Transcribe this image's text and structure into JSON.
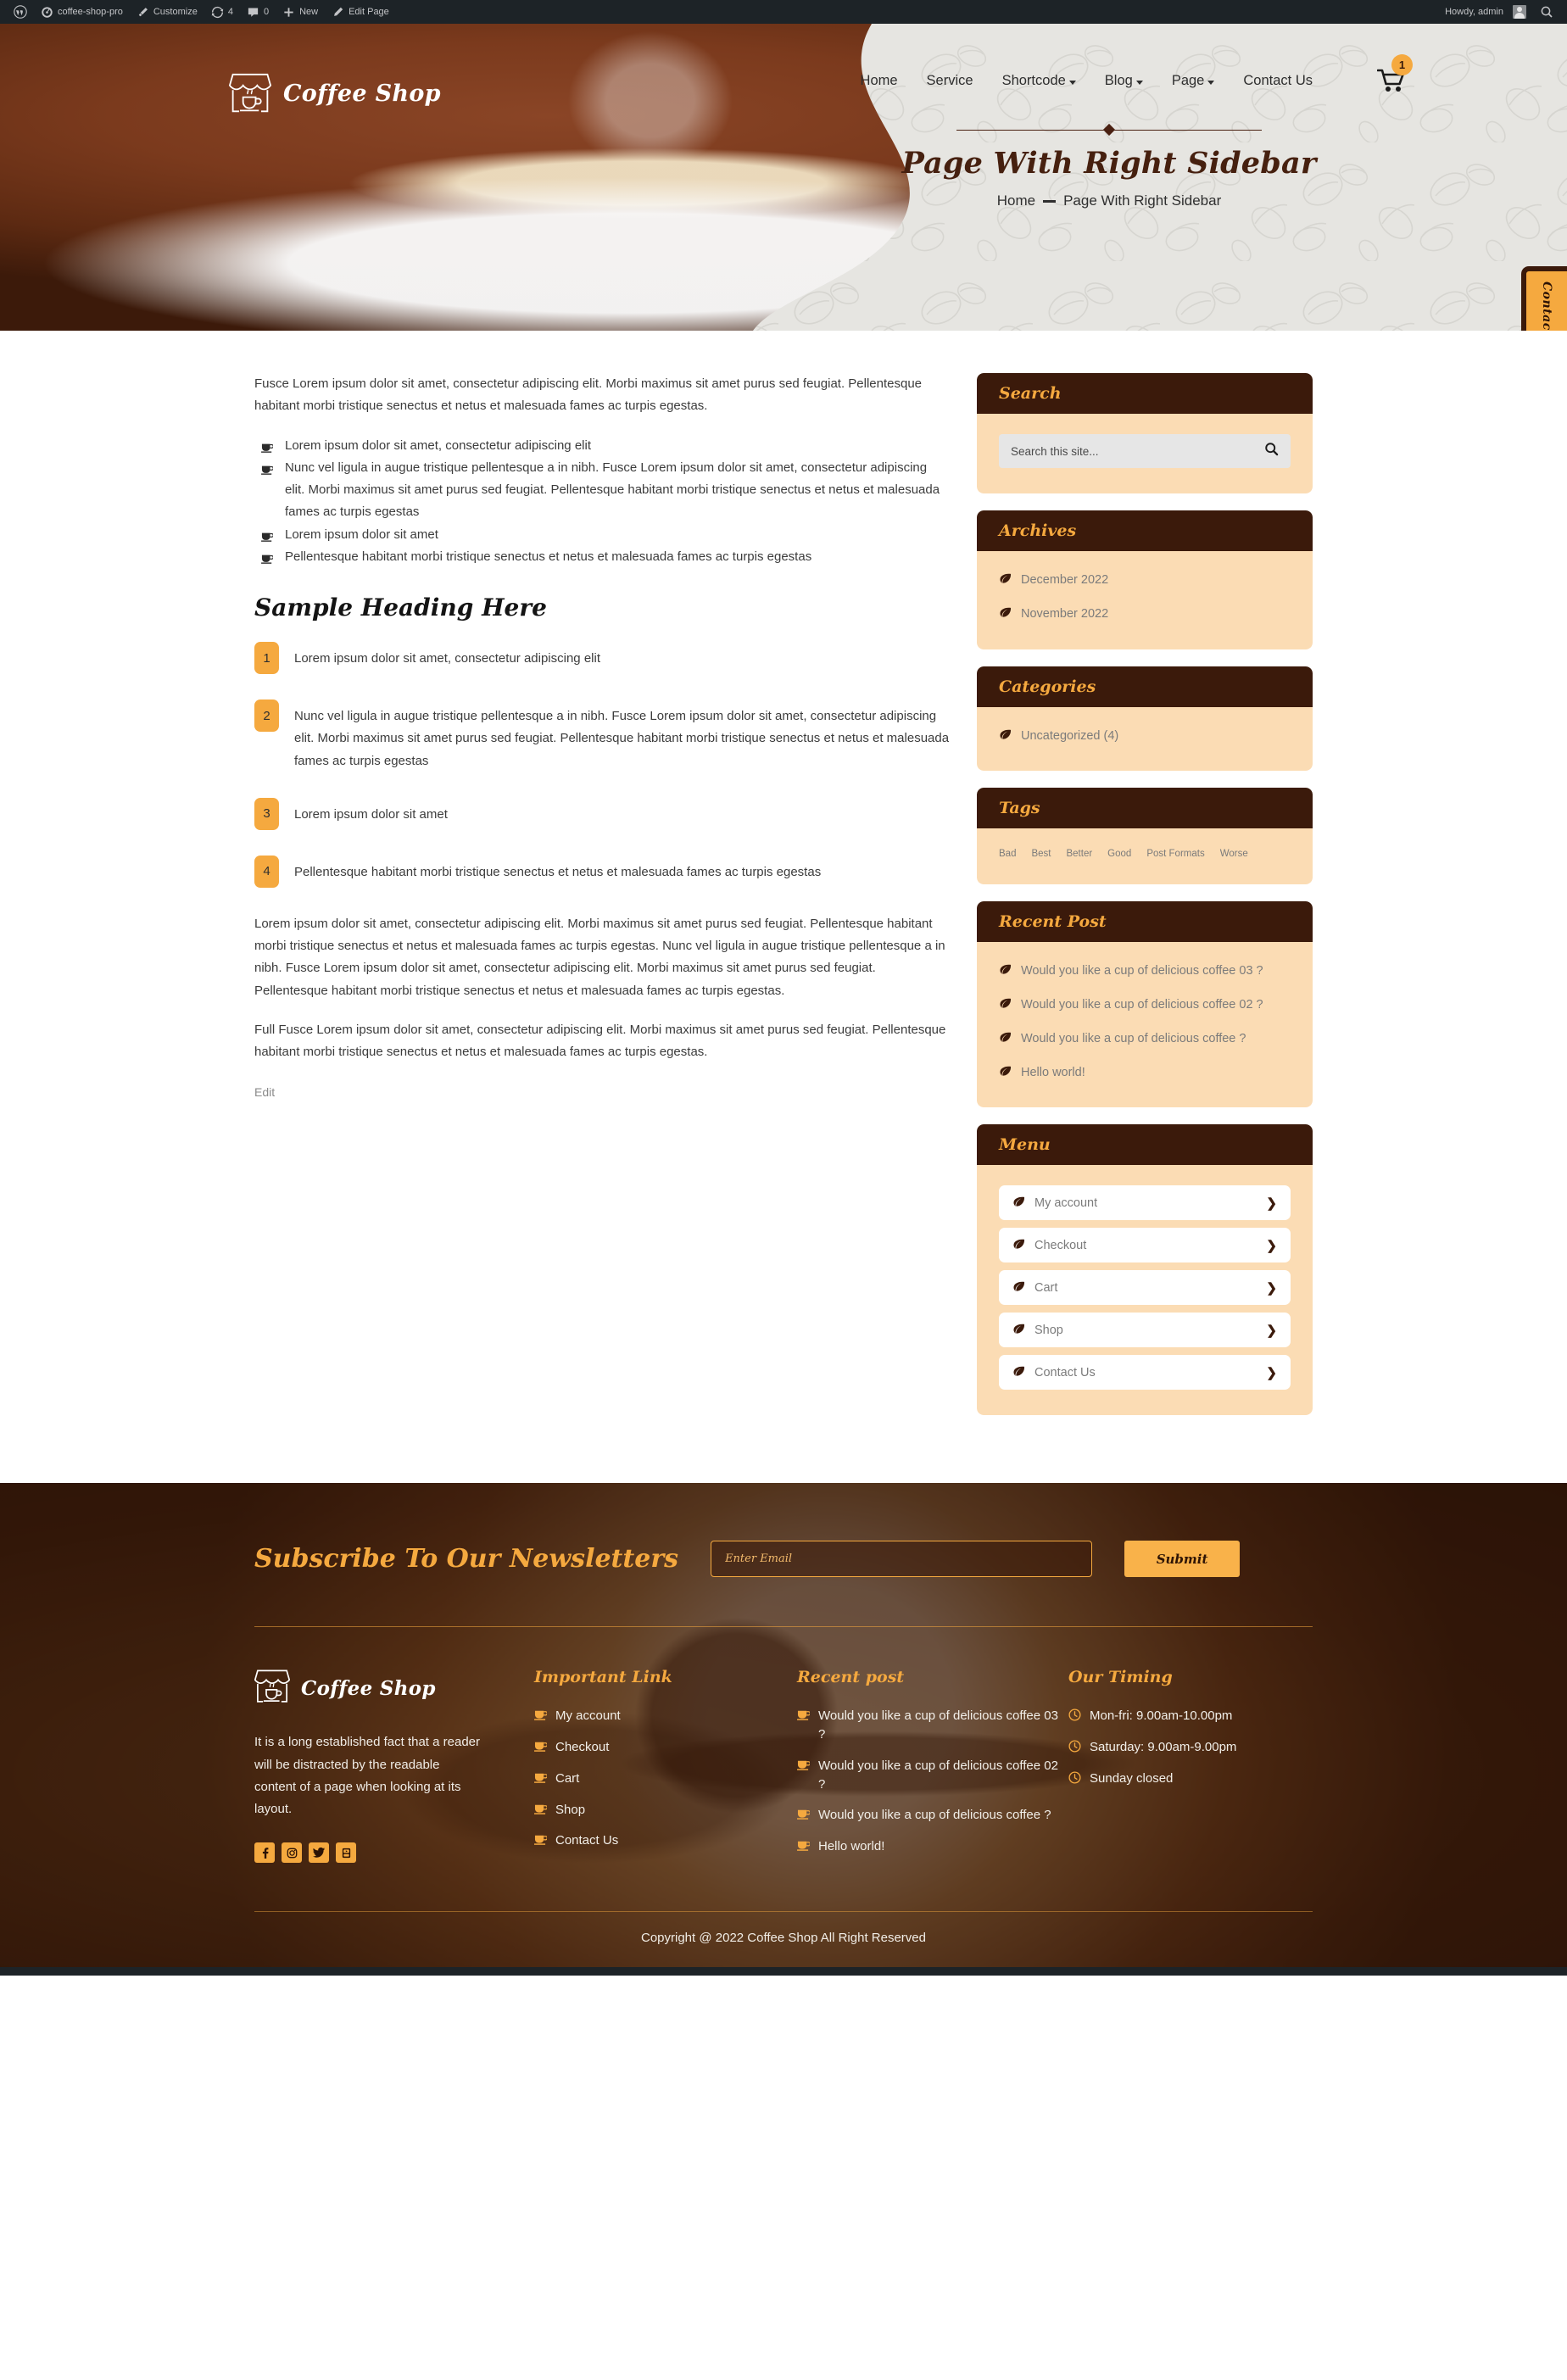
{
  "adminbar": {
    "items": [
      {
        "icon": "wordpress-icon",
        "label": ""
      },
      {
        "icon": "dashboard-icon",
        "label": "coffee-shop-pro"
      },
      {
        "icon": "brush-icon",
        "label": "Customize"
      },
      {
        "icon": "updates-icon",
        "label": "4"
      },
      {
        "icon": "comment-icon",
        "label": "0"
      },
      {
        "icon": "plus-icon",
        "label": "New"
      },
      {
        "icon": "pencil-icon",
        "label": "Edit Page"
      }
    ],
    "howdy": "Howdy, admin",
    "search_icon": "search-icon"
  },
  "header": {
    "brand": "Coffee Shop",
    "logo_icon": "storefront-coffee-logo-icon",
    "nav": [
      {
        "label": "Home",
        "has_caret": false
      },
      {
        "label": "Service",
        "has_caret": false
      },
      {
        "label": "Shortcode",
        "has_caret": true
      },
      {
        "label": "Blog",
        "has_caret": true
      },
      {
        "label": "Page",
        "has_caret": true
      },
      {
        "label": "Contact Us",
        "has_caret": false
      }
    ],
    "cart_icon": "shopping-cart-icon",
    "cart_count": "1",
    "page_title": "Page With Right Sidebar",
    "breadcrumb_home": "Home",
    "breadcrumb_current": "Page With Right Sidebar",
    "contact_tab": "Contact Us"
  },
  "content": {
    "intro": "Fusce Lorem ipsum dolor sit amet, consectetur adipiscing elit. Morbi maximus sit amet purus sed feugiat. Pellentesque habitant morbi tristique senectus et netus et malesuada fames ac turpis egestas.",
    "bullets": [
      "Lorem ipsum dolor sit amet, consectetur adipiscing elit",
      "Nunc vel ligula in augue tristique pellentesque a in nibh. Fusce Lorem ipsum dolor sit amet, consectetur adipiscing elit. Morbi maximus sit amet purus sed feugiat. Pellentesque habitant morbi tristique senectus et netus et malesuada fames ac turpis egestas",
      "Lorem ipsum dolor sit amet",
      "Pellentesque habitant morbi tristique senectus et netus et malesuada fames ac turpis egestas"
    ],
    "heading": "Sample Heading Here",
    "numbered": [
      {
        "n": "1",
        "text": "Lorem ipsum dolor sit amet, consectetur adipiscing elit"
      },
      {
        "n": "2",
        "text": "Nunc vel ligula in augue tristique pellentesque a in nibh. Fusce Lorem ipsum dolor sit amet, consectetur adipiscing elit. Morbi maximus sit amet purus sed feugiat. Pellentesque habitant morbi tristique senectus et netus et malesuada fames ac turpis egestas"
      },
      {
        "n": "3",
        "text": "Lorem ipsum dolor sit amet"
      },
      {
        "n": "4",
        "text": "Pellentesque habitant morbi tristique senectus et netus et malesuada fames ac turpis egestas"
      }
    ],
    "para2": "Lorem ipsum dolor sit amet, consectetur adipiscing elit. Morbi maximus sit amet purus sed feugiat. Pellentesque habitant morbi tristique senectus et netus et malesuada fames ac turpis egestas. Nunc vel ligula in augue tristique pellentesque a in nibh. Fusce Lorem ipsum dolor sit amet, consectetur adipiscing elit. Morbi maximus sit amet purus sed feugiat. Pellentesque habitant morbi tristique senectus et netus et malesuada fames ac turpis egestas.",
    "para3": "Full Fusce Lorem ipsum dolor sit amet, consectetur adipiscing elit. Morbi maximus sit amet purus sed feugiat. Pellentesque habitant morbi tristique senectus et netus et malesuada fames ac turpis egestas.",
    "edit": "Edit"
  },
  "sidebar": {
    "search": {
      "title": "Search",
      "placeholder": "Search this site...",
      "value": "",
      "icon": "search-icon"
    },
    "archives": {
      "title": "Archives",
      "items": [
        "December 2022",
        "November 2022"
      ]
    },
    "categories": {
      "title": "Categories",
      "items": [
        "Uncategorized (4)"
      ]
    },
    "tags": {
      "title": "Tags",
      "items": [
        "Bad",
        "Best",
        "Better",
        "Good",
        "Post Formats",
        "Worse"
      ]
    },
    "recent": {
      "title": "Recent Post",
      "items": [
        "Would you like a cup of delicious coffee 03 ?",
        "Would you like a cup of delicious coffee 02 ?",
        "Would you like a cup of delicious coffee ?",
        "Hello world!"
      ]
    },
    "menu": {
      "title": "Menu",
      "items": [
        "My account",
        "Checkout",
        "Cart",
        "Shop",
        "Contact Us"
      ]
    }
  },
  "footer": {
    "newsletter": {
      "title": "Subscribe To Our Newsletters",
      "placeholder": "Enter Email",
      "value": "",
      "submit": "Submit"
    },
    "brand": "Coffee Shop",
    "about": "It is a long established fact that a reader will be distracted by the readable content of a page when looking at its layout.",
    "socials": [
      "facebook-icon",
      "instagram-icon",
      "twitter-icon",
      "youtube-icon"
    ],
    "links": {
      "title": "Important Link",
      "items": [
        "My account",
        "Checkout",
        "Cart",
        "Shop",
        "Contact Us"
      ]
    },
    "recent": {
      "title": "Recent post",
      "items": [
        "Would you like a cup of delicious coffee 03 ?",
        "Would you like a cup of delicious coffee 02 ?",
        "Would you like a cup of delicious coffee ?",
        "Hello world!"
      ]
    },
    "timing": {
      "title": "Our Timing",
      "items": [
        "Mon-fri: 9.00am-10.00pm",
        "Saturday: 9.00am-9.00pm",
        "Sunday closed"
      ]
    },
    "copyright": "Copyright @ 2022 Coffee Shop All Right Reserved"
  },
  "colors": {
    "brand_dark": "#3b1a0b",
    "accent_orange": "#f5a93f",
    "widget_body": "#fbdcb4"
  }
}
